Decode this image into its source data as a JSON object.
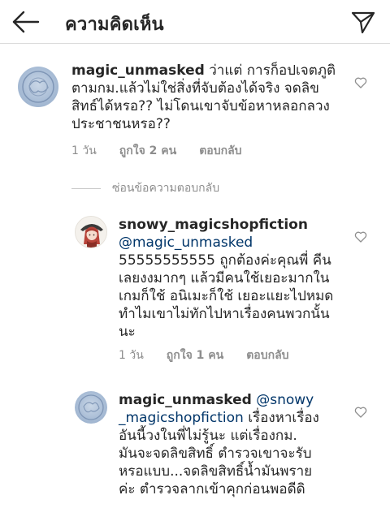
{
  "header": {
    "title": "ความคิดเห็น",
    "back_icon": "arrow-left-icon",
    "send_icon": "paper-plane-icon"
  },
  "comments": [
    {
      "username": "magic_unmasked",
      "mention": "",
      "text": "ว่าแต่ การก็อปเจตภูติตามกม.แล้วไม่ใช่สิ่งที่จับต้องได้จริง จดลิขสิทธ์ได้หรอ?? ไม่โดนเขาจับข้อหาหลอกลวงประชาชนหรอ??",
      "time": "1 วัน",
      "likes": "ถูกใจ 2 คน",
      "reply": "ตอบกลับ"
    },
    {
      "username": "snowy_magicshopfiction",
      "mention": "@magic_unmasked",
      "text": "55555555555 ถูกต้องค่ะคุณพี่ คีนเลยงงมากๆ แล้วมีคนใช้เยอะมากในเกมก็ใช้ อนิเมะก็ใช้ เยอะแยะไปหมด ทำไมเขาไม่ทักไปหาเรื่องคนพวกนั้นนะ",
      "time": "1 วัน",
      "likes": "ถูกใจ 1 คน",
      "reply": "ตอบกลับ"
    },
    {
      "username": "magic_unmasked",
      "mention": "@snowy _magicshopfiction",
      "text": "เรื่องหาเรื่องอันนี้วงในพี่ไม่รู้นะ แต่เรื่องกม. มันจะจดลิขสิทธิ์ ตำรวจเขาจะรับหรอแบบ...จดลิขสิทธิ์น้ำมันพรายค่ะ ตำรวจลากเข้าคุกก่อนพอดีดิ"
    }
  ],
  "view_replies": "ซ่อนข้อความตอบกลับ",
  "colors": {
    "text": "#262626",
    "secondary": "#8e8e8e",
    "mention": "#003569",
    "divider": "#dbdbdb"
  }
}
